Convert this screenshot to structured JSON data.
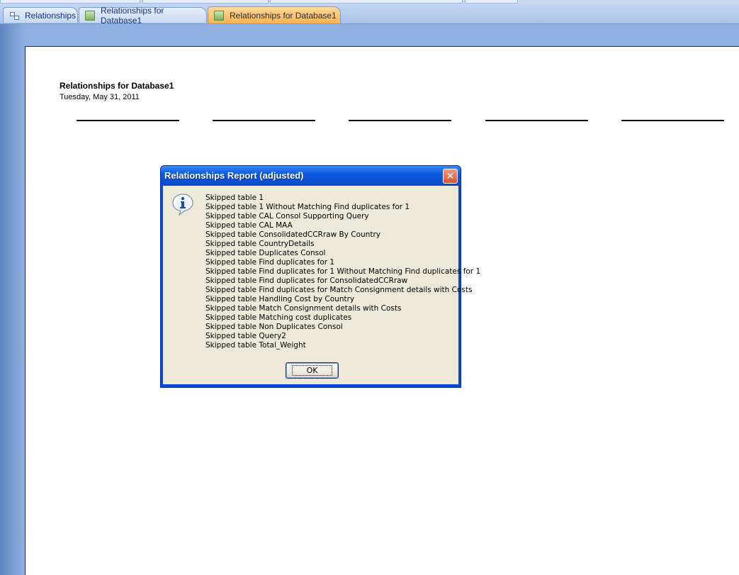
{
  "tabs": [
    {
      "label": "Relationships",
      "icon": "relationships-icon",
      "active": false
    },
    {
      "label": "Relationships for Database1",
      "icon": "report-icon",
      "active": false
    },
    {
      "label": "Relationships for Database1",
      "icon": "report-icon",
      "active": true
    }
  ],
  "report": {
    "title": "Relationships for Database1",
    "date": "Tuesday, May 31, 2011"
  },
  "dialog": {
    "title": "Relationships Report (adjusted)",
    "close_label": "✕",
    "icon": "info-icon",
    "messages": [
      "Skipped table 1",
      "Skipped table 1 Without Matching Find duplicates for 1",
      "Skipped table CAL Consol Supporting Query",
      "Skipped table CAL MAA",
      "Skipped table ConsolidatedCCRraw By Country",
      "Skipped table CountryDetails",
      "Skipped table Duplicates Consol",
      "Skipped table Find duplicates for 1",
      "Skipped table Find duplicates for 1 Without Matching Find duplicates for 1",
      "Skipped table Find duplicates for ConsolidatedCCRraw",
      "Skipped table Find duplicates for Match Consignment details with Costs",
      "Skipped table Handling Cost by Country",
      "Skipped table Match Consignment details with Costs",
      "Skipped table Matching cost duplicates",
      "Skipped table Non Duplicates Consol",
      "Skipped table Query2",
      "Skipped table Total_Weight"
    ],
    "ok_label": "OK"
  },
  "colors": {
    "active_tab": "#f7b451",
    "dialog_title_bar": "#0a5ae0",
    "dialog_body": "#ece9d8",
    "close_button": "#d9532e"
  }
}
